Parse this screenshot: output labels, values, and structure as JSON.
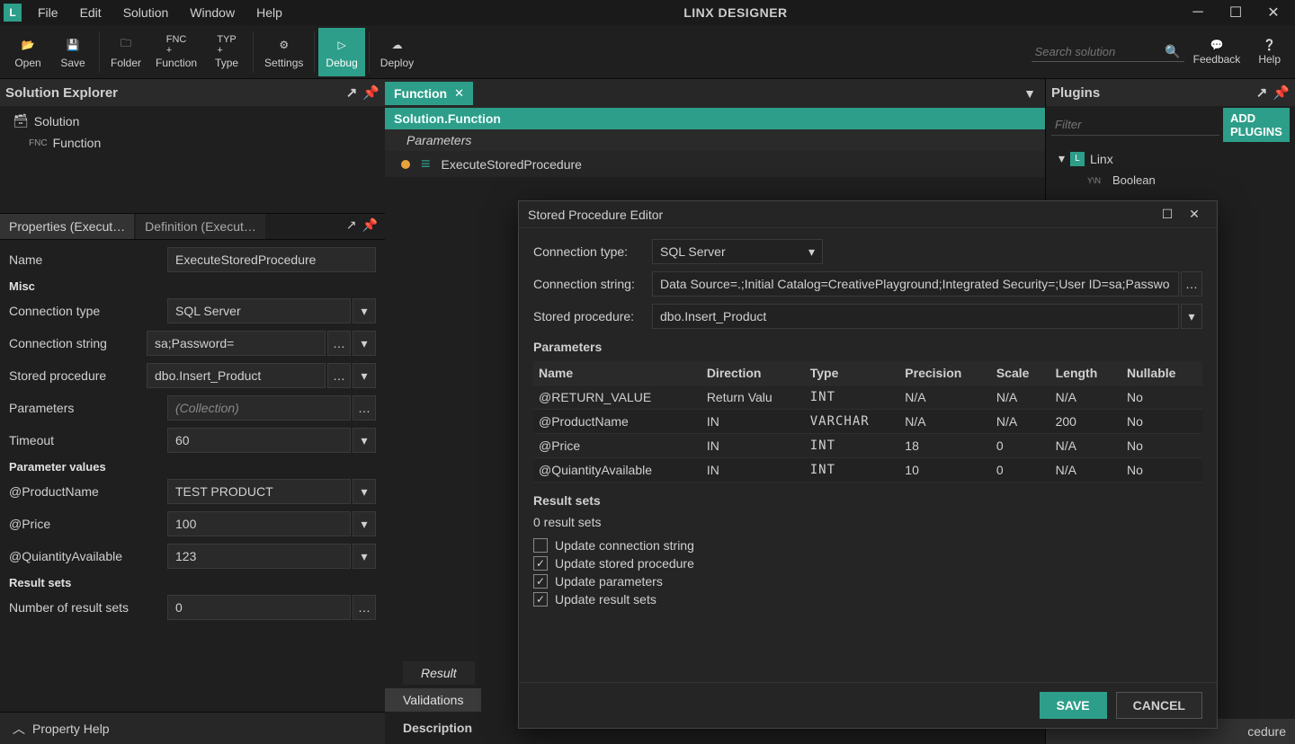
{
  "app": {
    "title": "LINX DESIGNER"
  },
  "menu": {
    "file": "File",
    "edit": "Edit",
    "solution": "Solution",
    "window": "Window",
    "help": "Help"
  },
  "toolbar": {
    "open": "Open",
    "save": "Save",
    "folder": "Folder",
    "function": "Function",
    "type": "Type",
    "settings": "Settings",
    "debug": "Debug",
    "deploy": "Deploy",
    "search_placeholder": "Search solution",
    "feedback": "Feedback",
    "help": "Help"
  },
  "solution_explorer": {
    "title": "Solution Explorer",
    "root": "Solution",
    "child_tag": "FNC",
    "child": "Function"
  },
  "props_tabs": {
    "properties": "Properties (Execut…",
    "definition": "Definition (Execut…"
  },
  "props": {
    "name_label": "Name",
    "name_value": "ExecuteStoredProcedure",
    "misc_section": "Misc",
    "conn_type_label": "Connection type",
    "conn_type_value": "SQL Server",
    "conn_string_label": "Connection string",
    "conn_string_value": "sa;Password=",
    "stored_proc_label": "Stored procedure",
    "stored_proc_value": "dbo.Insert_Product",
    "params_label": "Parameters",
    "params_value": "(Collection)",
    "timeout_label": "Timeout",
    "timeout_value": "60",
    "param_values_section": "Parameter values",
    "product_name_label": "@ProductName",
    "product_name_value": "TEST PRODUCT",
    "price_label": "@Price",
    "price_value": "100",
    "qty_label": "@QuiantityAvailable",
    "qty_value": "123",
    "result_sets_section": "Result sets",
    "result_count_label": "Number of result sets",
    "result_count_value": "0",
    "property_help": "Property Help"
  },
  "editor": {
    "tab": "Function",
    "path": "Solution.Function",
    "params_header": "Parameters",
    "item": "ExecuteStoredProcedure",
    "result_tab": "Result",
    "validations_tab": "Validations",
    "description": "Description"
  },
  "plugins": {
    "title": "Plugins",
    "filter_placeholder": "Filter",
    "add_btn": "ADD PLUGINS",
    "linx": "Linx",
    "boolean_tag": "Y\\N",
    "boolean": "Boolean",
    "truncated_item": "cedure"
  },
  "dialog": {
    "title": "Stored Procedure Editor",
    "conn_type_label": "Connection type:",
    "conn_type_value": "SQL Server",
    "conn_string_label": "Connection string:",
    "conn_string_value": "Data Source=.;Initial Catalog=CreativePlayground;Integrated Security=;User ID=sa;Passwo",
    "stored_proc_label": "Stored procedure:",
    "stored_proc_value": "dbo.Insert_Product",
    "params_section": "Parameters",
    "cols": {
      "name": "Name",
      "direction": "Direction",
      "type": "Type",
      "precision": "Precision",
      "scale": "Scale",
      "length": "Length",
      "nullable": "Nullable"
    },
    "rows": [
      {
        "name": "@RETURN_VALUE",
        "direction": "Return Valu",
        "type": "INT",
        "precision": "N/A",
        "scale": "N/A",
        "length": "N/A",
        "nullable": "No"
      },
      {
        "name": "@ProductName",
        "direction": "IN",
        "type": "VARCHAR",
        "precision": "N/A",
        "scale": "N/A",
        "length": "200",
        "nullable": "No"
      },
      {
        "name": "@Price",
        "direction": "IN",
        "type": "INT",
        "precision": "18",
        "scale": "0",
        "length": "N/A",
        "nullable": "No"
      },
      {
        "name": "@QuiantityAvailable",
        "direction": "IN",
        "type": "INT",
        "precision": "10",
        "scale": "0",
        "length": "N/A",
        "nullable": "No"
      }
    ],
    "result_sets_section": "Result sets",
    "result_sets_count": "0 result sets",
    "chk_conn": "Update connection string",
    "chk_proc": "Update stored procedure",
    "chk_params": "Update parameters",
    "chk_results": "Update result sets",
    "save_btn": "SAVE",
    "cancel_btn": "CANCEL"
  }
}
